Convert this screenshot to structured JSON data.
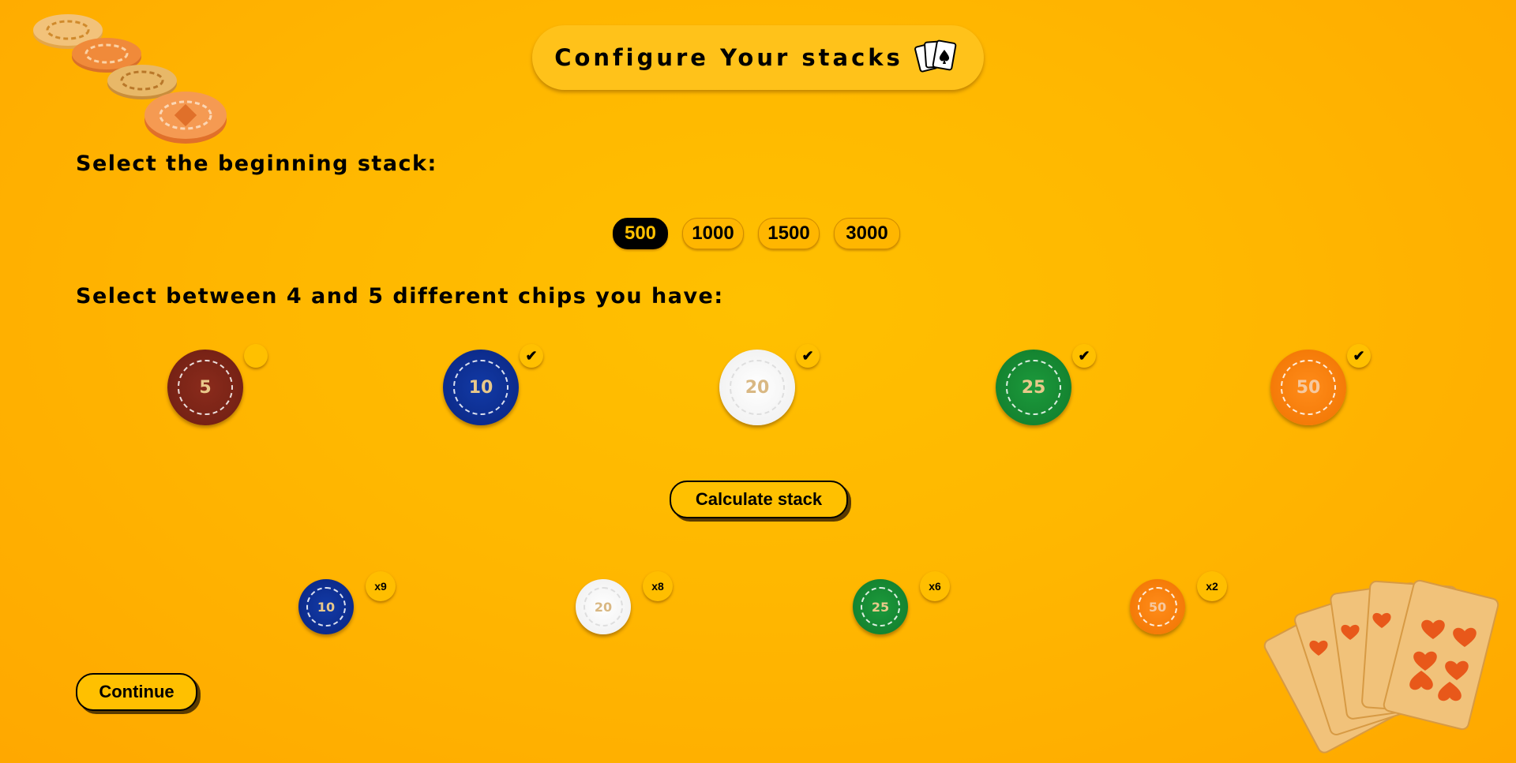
{
  "header": {
    "title": "Configure Your stacks",
    "title_icon": "playing-cards-icon"
  },
  "stack_section": {
    "heading": "Select the beginning stack:",
    "options": [
      "500",
      "1000",
      "1500",
      "3000"
    ],
    "selected": "500"
  },
  "chips_section": {
    "heading": "Select between 4 and 5 different chips you have:",
    "chips": [
      {
        "value": "5",
        "color": "#7a2416",
        "checked": false
      },
      {
        "value": "10",
        "color": "#0e2f96",
        "checked": true
      },
      {
        "value": "20",
        "color": "#f4f4f4",
        "checked": true
      },
      {
        "value": "25",
        "color": "#168a33",
        "checked": true
      },
      {
        "value": "50",
        "color": "#f77f0f",
        "checked": true
      }
    ],
    "check_mark": "✔"
  },
  "calculate_button": {
    "label": "Calculate stack"
  },
  "result": {
    "chips": [
      {
        "value": "10",
        "count": "x9"
      },
      {
        "value": "20",
        "count": "x8"
      },
      {
        "value": "25",
        "count": "x6"
      },
      {
        "value": "50",
        "count": "x2"
      }
    ]
  },
  "continue_button": {
    "label": "Continue"
  },
  "decorations": {
    "top_left": "poker-chips-stack-icon",
    "bottom_right": "royal-flush-cards-icon"
  },
  "colors": {
    "background": "#ffb800",
    "accent": "#ffc000",
    "text": "#000000"
  }
}
